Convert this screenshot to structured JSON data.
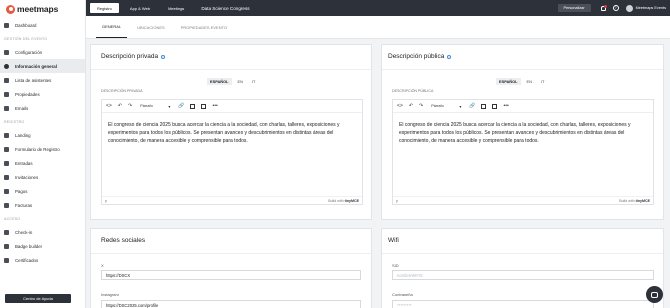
{
  "brand": {
    "name": "meetmaps"
  },
  "sidebar": {
    "items": [
      {
        "label": "Dashboard",
        "icon": "dashboard-icon"
      },
      {
        "section": "GESTIÓN DEL EVENTO"
      },
      {
        "label": "Configuración",
        "icon": "gear-icon"
      },
      {
        "label": "Información general",
        "icon": "info-icon",
        "active": true
      },
      {
        "label": "Lista de asistentes",
        "icon": "users-icon"
      },
      {
        "label": "Propiedades",
        "icon": "properties-icon"
      },
      {
        "label": "Emails",
        "icon": "mail-icon"
      },
      {
        "section": "REGISTRO"
      },
      {
        "label": "Landing",
        "icon": "globe-icon"
      },
      {
        "label": "Formulario de Registro",
        "icon": "form-icon"
      },
      {
        "label": "Entradas",
        "icon": "ticket-icon"
      },
      {
        "label": "Invitaciones",
        "icon": "invite-icon"
      },
      {
        "label": "Pagos",
        "icon": "card-icon"
      },
      {
        "label": "Facturas",
        "icon": "invoice-icon"
      },
      {
        "section": "ACCESO"
      },
      {
        "label": "Check-in",
        "icon": "checkin-icon"
      },
      {
        "label": "Badge builder",
        "icon": "badge-icon"
      },
      {
        "label": "Certificados",
        "icon": "certificate-icon"
      }
    ],
    "help_button": "Centro de Ayuda"
  },
  "topbar": {
    "tabs": [
      {
        "label": "Registro",
        "active": true
      },
      {
        "label": "App & Web",
        "active": false
      },
      {
        "label": "Meetings",
        "active": false
      }
    ],
    "event_title": "Data Science Congress",
    "customize_label": "Personalizar",
    "user_name": "Meetmaps Events"
  },
  "subtabs": [
    {
      "label": "GENERAL",
      "active": true
    },
    {
      "label": "UBICACIONES",
      "active": false
    },
    {
      "label": "PROPIEDADES EVENTO",
      "active": false
    }
  ],
  "private_desc": {
    "title": "Descripción privada",
    "langs": [
      "ESPAÑOL",
      "EN",
      "IT"
    ],
    "editor_label": "DESCRIPCIÓN PRIVADA",
    "paragraph_select": "Párrafo",
    "body": "El congreso de ciencia 2025 busca acercar la ciencia a la sociedad, con charlas, talleres, exposiciones y experimentos para todos los públicos. Se presentan avances y descubrimientos en distintas áreas del conocimiento, de manera accesible y comprensible para todos.",
    "footer_left": "p",
    "footer_right": "Build with",
    "tinymce": "tinyMCE"
  },
  "public_desc": {
    "title": "Descripción pública",
    "langs": [
      "ESPAÑOL",
      "EN",
      "IT"
    ],
    "editor_label": "DESCRIPCIÓN PÚBLICA",
    "paragraph_select": "Párrafo",
    "body": "El congreso de ciencia 2025 busca acercar la ciencia a la sociedad, con charlas, talleres, exposiciones y experimentos para todos los públicos. Se presentan avances y descubrimientos en distintas áreas del conocimiento, de manera accesible y comprensible para todos.",
    "footer_left": "p",
    "footer_right": "Build with",
    "tinymce": "tinyMCE"
  },
  "social": {
    "title": "Redes sociales",
    "x_label": "X",
    "x_value": "https://DSCX",
    "instagram_label": "Instagram",
    "instagram_value": "https://DSC2025.com/profile"
  },
  "wifi": {
    "title": "Wifi",
    "ssid_label": "SID",
    "ssid_placeholder": "nombreWIFIS",
    "password_label": "Contraseña",
    "password_placeholder": "*********"
  }
}
